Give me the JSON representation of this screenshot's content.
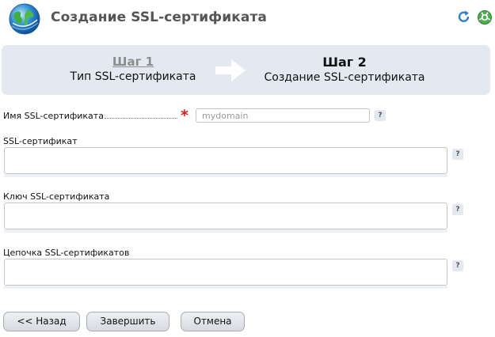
{
  "header": {
    "title": "Создание SSL-сертификата",
    "logo_icon": "globe-icon",
    "refresh_icon": "refresh-icon",
    "help_icon": "help-icon"
  },
  "steps": {
    "step1": {
      "number": "Шаг 1",
      "label": "Тип SSL-сертификата"
    },
    "step2": {
      "number": "Шаг 2",
      "label": "Создание SSL-сертификата"
    },
    "arrow_icon": "arrow-right-icon"
  },
  "form": {
    "name": {
      "label": "Имя SSL-сертификата",
      "required": "*",
      "placeholder": "mydomain",
      "value": ""
    },
    "certificate": {
      "label": "SSL-сертификат",
      "value": ""
    },
    "key": {
      "label": "Ключ SSL-сертификата",
      "value": ""
    },
    "chain": {
      "label": "Цепочка SSL-сертификатов",
      "value": ""
    },
    "help_label": "?"
  },
  "buttons": {
    "back": "<< Назад",
    "finish": "Завершить",
    "cancel": "Отмена"
  },
  "colors": {
    "steps_bg": "#e3e8f1",
    "required": "#e01818",
    "title": "#555555"
  }
}
